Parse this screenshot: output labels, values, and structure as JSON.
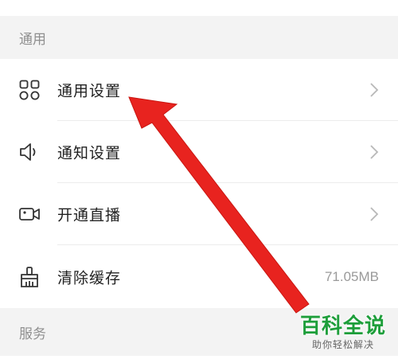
{
  "sections": {
    "general": "通用",
    "services": "服务"
  },
  "rows": [
    {
      "label": "通用设置",
      "icon": "grid-icon",
      "has_chevron": true
    },
    {
      "label": "通知设置",
      "icon": "speaker-icon",
      "has_chevron": true
    },
    {
      "label": "开通直播",
      "icon": "video-camera-icon",
      "has_chevron": true
    },
    {
      "label": "清除缓存",
      "icon": "broom-icon",
      "value": "71.05MB"
    }
  ],
  "watermark": {
    "main": "百科全说",
    "sub": "助你轻松解决"
  },
  "colors": {
    "section_bg": "#f3f3f3",
    "arrow": "#e8231f",
    "watermark_green": "#1d9e3a"
  }
}
